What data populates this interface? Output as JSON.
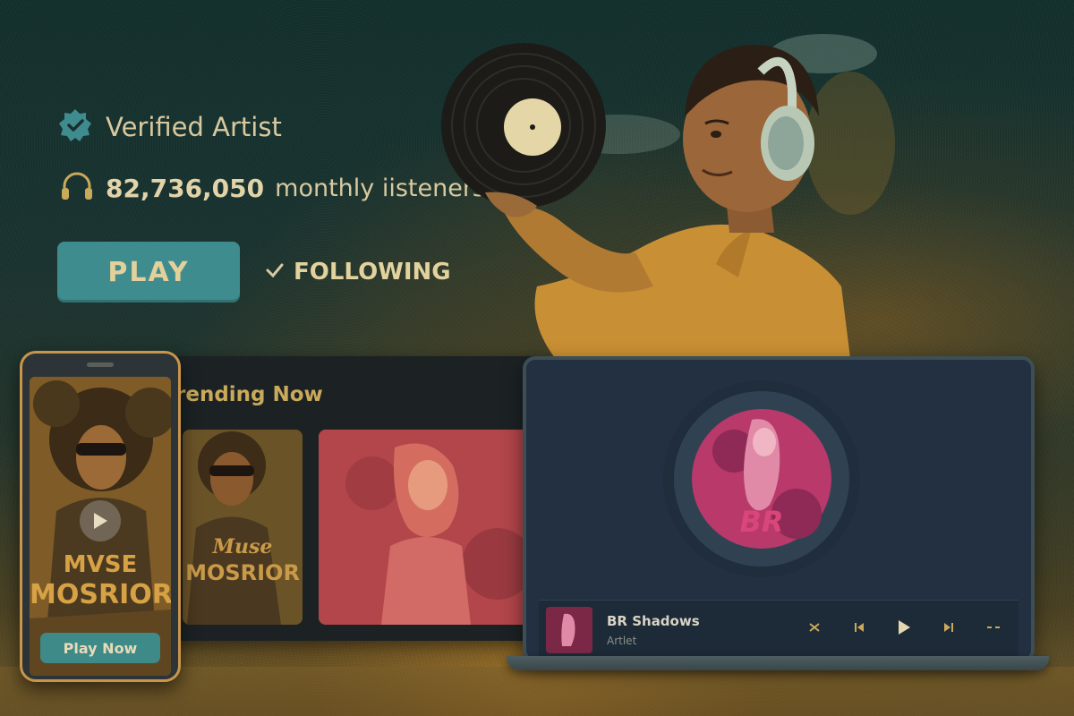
{
  "artist": {
    "verified_label": "Verified Artist",
    "listeners_count": "82,736,050",
    "listeners_label": "monthly iisteners",
    "play_label": "PLAY",
    "following_label": "FOLLOWING"
  },
  "trending": {
    "title": "rending Now",
    "cards": [
      {
        "title_line1": "Muse",
        "title_line2": "MOSRIOR"
      },
      {
        "title_line1": "",
        "title_line2": ""
      }
    ]
  },
  "phone": {
    "album_line1": "MVSE",
    "album_line2": "MOSRIOR",
    "play_now_label": "Play Now"
  },
  "laptop": {
    "disc_text": "BR",
    "now_playing_title": "BR Shadows",
    "now_playing_artist": "Artlet"
  },
  "icons": {
    "verified": "verified-badge-icon",
    "headphones": "headphones-icon",
    "check": "check-icon",
    "shuffle": "shuffle-icon",
    "previous": "previous-icon",
    "play": "play-icon",
    "next": "next-icon",
    "more": "more-icon"
  },
  "colors": {
    "accent_teal": "#3f8c8f",
    "text_cream": "#d8c9a0",
    "gold": "#c9a95a",
    "pink": "#d9467a"
  }
}
